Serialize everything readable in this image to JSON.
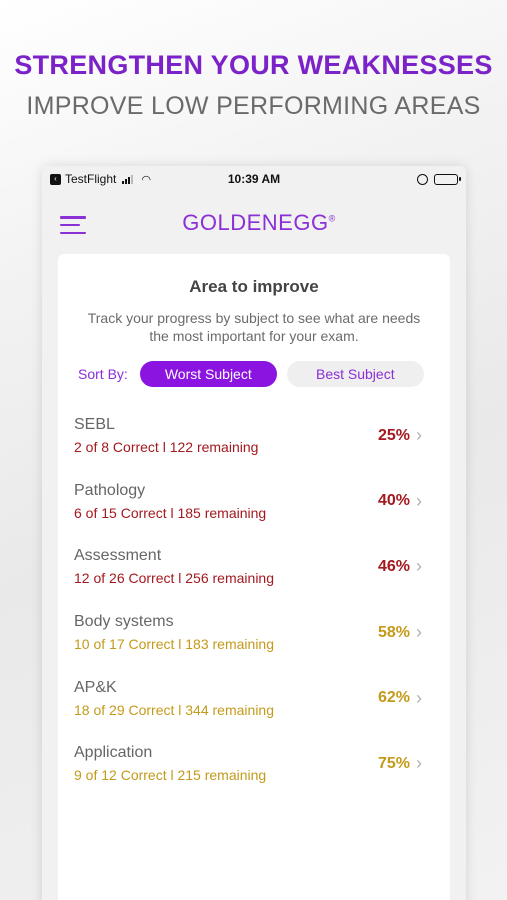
{
  "promo": {
    "headline": "STRENGTHEN YOUR WEAKNESSES",
    "subline": "IMPROVE LOW PERFORMING AREAS"
  },
  "status_bar": {
    "carrier": "TestFlight",
    "time": "10:39 AM",
    "battery_level": 0.9
  },
  "nav": {
    "menu_icon": "hamburger-icon",
    "logo": "GOLDENEGG",
    "logo_mark": "®"
  },
  "card": {
    "title": "Area to improve",
    "description": "Track your progress by subject to see what are needs the most important for your exam.",
    "sort_label": "Sort By:",
    "sort_options": [
      "Worst Subject",
      "Best Subject"
    ],
    "active_sort": "Worst Subject"
  },
  "colors": {
    "brand_purple": "#8b14e0",
    "low_score_red": "#a3191f",
    "mid_score_gold": "#c49a1a"
  },
  "subjects": [
    {
      "name": "SEBL",
      "detail": "2 of 8  Correct l 122 remaining",
      "percent": "25%",
      "color": "#a3191f"
    },
    {
      "name": "Pathology",
      "detail": "6 of 15  Correct l 185 remaining",
      "percent": "40%",
      "color": "#a3191f"
    },
    {
      "name": "Assessment",
      "detail": "12 of 26  Correct l 256 remaining",
      "percent": "46%",
      "color": "#a3191f"
    },
    {
      "name": "Body systems",
      "detail": "10 of 17  Correct l 183 remaining",
      "percent": "58%",
      "color": "#c49a1a"
    },
    {
      "name": "AP&K",
      "detail": "18 of 29  Correct l 344 remaining",
      "percent": "62%",
      "color": "#c49a1a"
    },
    {
      "name": "Application",
      "detail": "9 of 12  Correct l 215 remaining",
      "percent": "75%",
      "color": "#c49a1a"
    }
  ]
}
